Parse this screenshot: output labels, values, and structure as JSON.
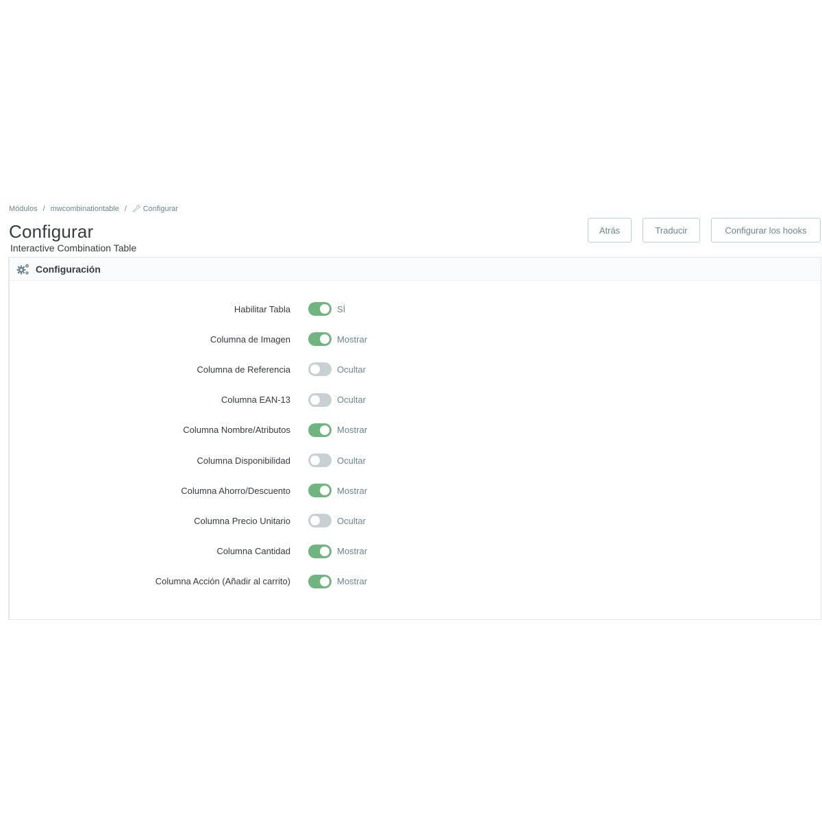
{
  "breadcrumb": {
    "items": [
      "Módulos",
      "mwcombinationtable",
      "Configurar"
    ],
    "separator": "/"
  },
  "header": {
    "title": "Configurar",
    "subtitle": "Interactive Combination Table"
  },
  "toolbar": {
    "back_label": "Atrás",
    "translate_label": "Traducir",
    "hooks_label": "Configurar los hooks"
  },
  "panel": {
    "heading": "Configuración",
    "icon": "gears-icon"
  },
  "settings": [
    {
      "label": "Habilitar Tabla",
      "enabled": true,
      "state": "SÍ"
    },
    {
      "label": "Columna de Imagen",
      "enabled": true,
      "state": "Mostrar"
    },
    {
      "label": "Columna de Referencia",
      "enabled": false,
      "state": "Ocultar"
    },
    {
      "label": "Columna EAN-13",
      "enabled": false,
      "state": "Ocultar"
    },
    {
      "label": "Columna Nombre/Atributos",
      "enabled": true,
      "state": "Mostrar"
    },
    {
      "label": "Columna Disponibilidad",
      "enabled": false,
      "state": "Ocultar"
    },
    {
      "label": "Columna Ahorro/Descuento",
      "enabled": true,
      "state": "Mostrar"
    },
    {
      "label": "Columna Precio Unitario",
      "enabled": false,
      "state": "Ocultar"
    },
    {
      "label": "Columna Cantidad",
      "enabled": true,
      "state": "Mostrar"
    },
    {
      "label": "Columna Acción (Añadir al carrito)",
      "enabled": true,
      "state": "Mostrar"
    }
  ],
  "colors": {
    "toggle_on": "#70b580",
    "toggle_off": "#c8d0d4",
    "button_border": "#bbcdd2",
    "muted_text": "#6c868e"
  }
}
